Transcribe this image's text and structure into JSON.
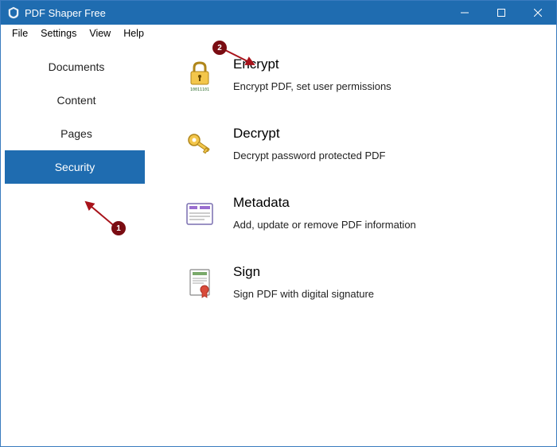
{
  "app": {
    "title": "PDF Shaper Free"
  },
  "menubar": {
    "items": [
      "File",
      "Settings",
      "View",
      "Help"
    ]
  },
  "sidebar": {
    "items": [
      {
        "label": "Documents",
        "active": false
      },
      {
        "label": "Content",
        "active": false
      },
      {
        "label": "Pages",
        "active": false
      },
      {
        "label": "Security",
        "active": true
      }
    ]
  },
  "main": {
    "options": [
      {
        "icon": "lock-icon",
        "title": "Encrypt",
        "desc": "Encrypt PDF, set user permissions"
      },
      {
        "icon": "key-icon",
        "title": "Decrypt",
        "desc": "Decrypt password protected PDF"
      },
      {
        "icon": "metadata-icon",
        "title": "Metadata",
        "desc": "Add, update or remove PDF information"
      },
      {
        "icon": "certificate-icon",
        "title": "Sign",
        "desc": "Sign PDF with digital signature"
      }
    ]
  },
  "annotations": {
    "callout1": "1",
    "callout2": "2"
  }
}
